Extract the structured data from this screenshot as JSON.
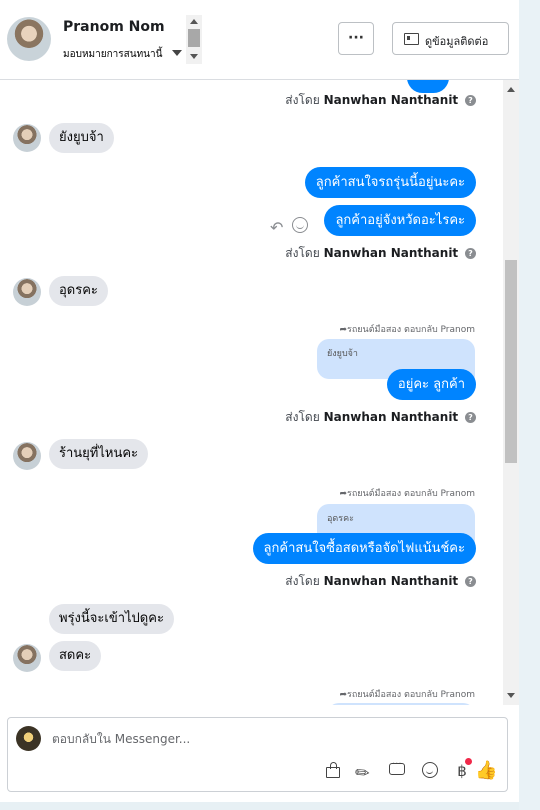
{
  "header": {
    "contact_name": "Pranom Nom",
    "assign_label": "มอบหมายการสนทนานี้",
    "more_label": "···",
    "contact_info_label": "ดูข้อมูลติดต่อ"
  },
  "messages": {
    "sent_by_prefix": "ส่งโดย",
    "agent_name": "Nanwhan Nanthanit",
    "incoming_1": "ยังยูบจ้า",
    "outgoing_1": "ลูกค้าสนใจรถรุ่นนี้อยู่นะคะ",
    "outgoing_2": "ลูกค้าอยู่จังหวัดอะไรคะ",
    "incoming_2": "อุดรคะ",
    "reply_header": "รถยนต์มือสอง ตอบกลับ Pranom",
    "quoted_1": "ยังยูบจ้า",
    "outgoing_3": "อยู่คะ ลูกค้า",
    "incoming_3": "ร้านยุที่ไหนคะ",
    "quoted_2": "อุดรคะ",
    "outgoing_4": "ลูกค้าสนใจซื้อสดหรือจัดไฟแน้นช์คะ",
    "incoming_4": "พรุ่งนี้จะเข้าไปดูคะ",
    "incoming_5": "สดคะ"
  },
  "composer": {
    "placeholder": "ตอบกลับใน Messenger..."
  },
  "icons": {
    "info": "info-icon",
    "reply": "reply-icon",
    "emoji": "emoji-icon",
    "bag": "shopping-bag-icon",
    "clip": "paperclip-icon",
    "chat": "saved-replies-icon",
    "baht": "baht-payment-icon",
    "like": "thumbs-up-icon"
  },
  "colors": {
    "outgoing_bubble": "#0084ff",
    "incoming_bubble": "#e4e6eb",
    "quoted_bubble": "#cfe3fd",
    "notification_dot": "#f02849"
  }
}
